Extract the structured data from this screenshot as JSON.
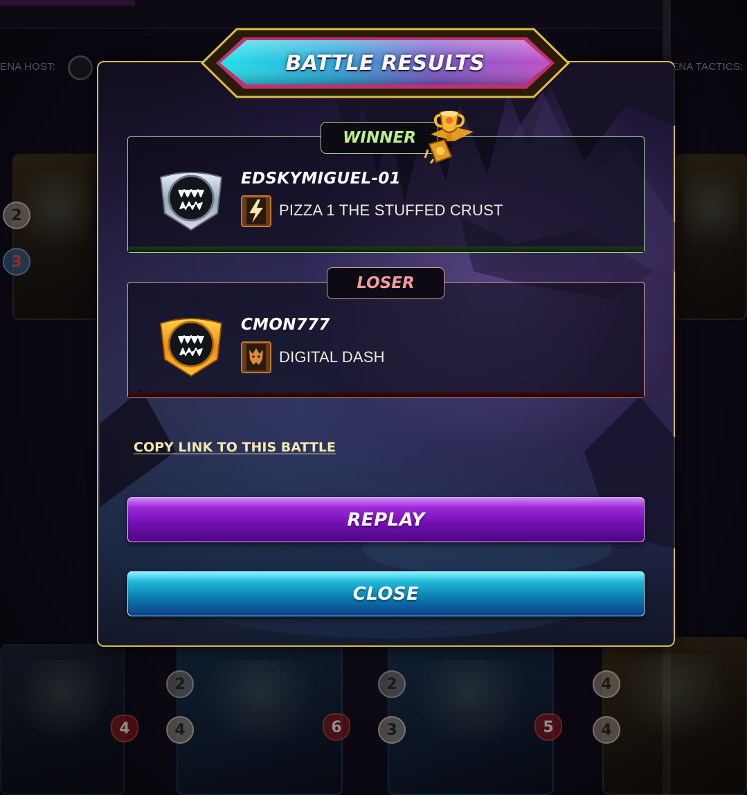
{
  "background": {
    "arena_host_label": "ENA HOST:",
    "arena_tactics_label": "ENA TACTICS:",
    "cards": [
      {
        "id": "left-top",
        "stats": [
          "2",
          "3"
        ]
      },
      {
        "id": "bottom-1",
        "stats": [
          "4"
        ]
      },
      {
        "id": "bottom-2",
        "stats": [
          "2",
          "4",
          "6"
        ]
      },
      {
        "id": "bottom-3",
        "stats": [
          "2",
          "3",
          "5"
        ]
      },
      {
        "id": "bottom-4",
        "stats": [
          "4",
          "4"
        ]
      }
    ]
  },
  "modal": {
    "title": "BATTLE RESULTS",
    "winner": {
      "badge": "WINNER",
      "player_name": "EDSKYMIGUEL-01",
      "guild_name": "PIZZA 1 THE STUFFED CRUST",
      "avatar_icon": "silver-league-fangs-icon",
      "guild_icon": "lightning-banner-icon"
    },
    "loser": {
      "badge": "LOSER",
      "player_name": "CMON777",
      "guild_name": "DIGITAL DASH",
      "avatar_icon": "gold-league-fangs-icon",
      "guild_icon": "wolf-banner-icon"
    },
    "copy_link_label": "COPY LINK TO THIS BATTLE",
    "replay_label": "REPLAY",
    "close_label": "CLOSE"
  },
  "colors": {
    "frame_gold": "#d8b949",
    "winner_green": "#9fd88f",
    "loser_red": "#e29b9b",
    "replay_purple": "#7611b7",
    "close_teal": "#0d82b3"
  }
}
